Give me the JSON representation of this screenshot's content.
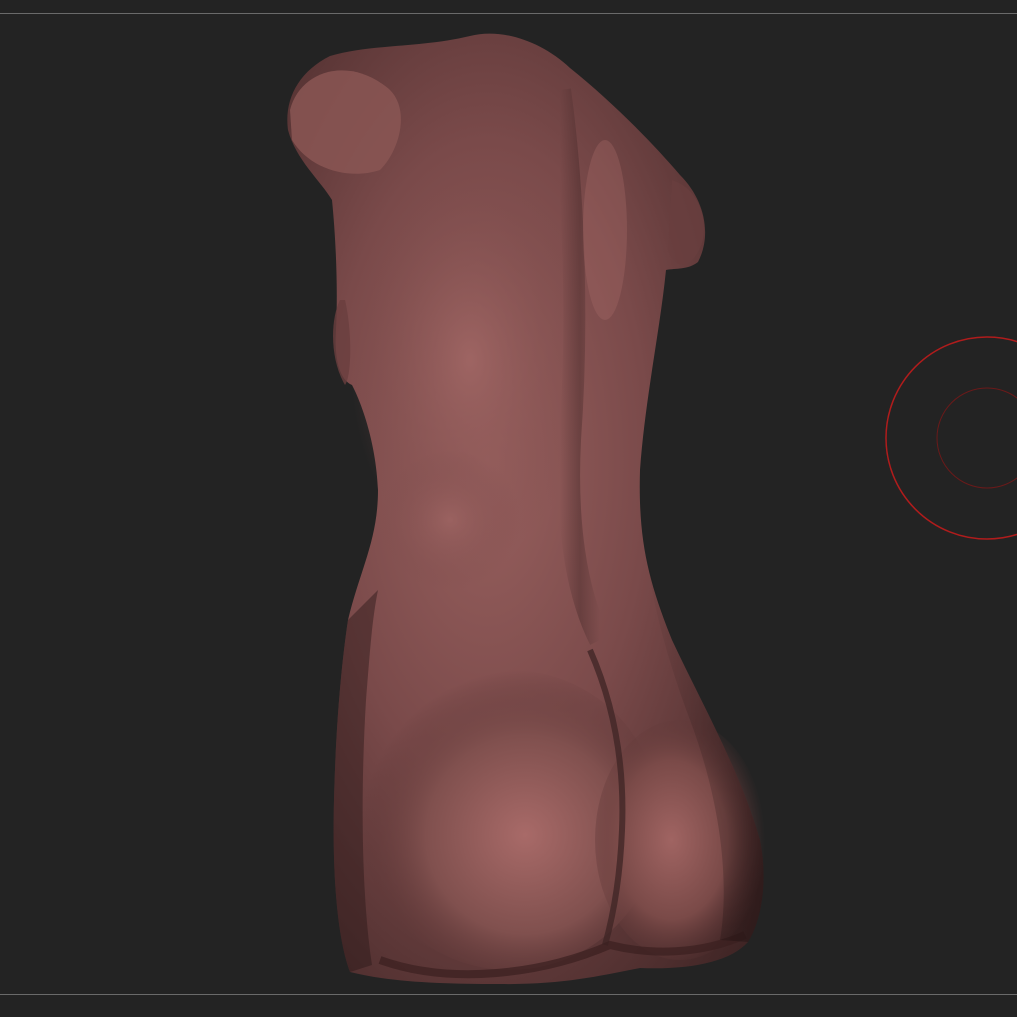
{
  "viewport": {
    "background": "#232323",
    "frame_line_color": "#6a6a6a"
  },
  "model": {
    "material_base": "#7a4a4a",
    "material_highlight": "#a86a68",
    "material_shadow": "#3e2424"
  },
  "brush_cursor": {
    "icon": "brush-cursor-icon",
    "outer_color": "#b01c1c",
    "inner_color": "#6a1a1a"
  }
}
